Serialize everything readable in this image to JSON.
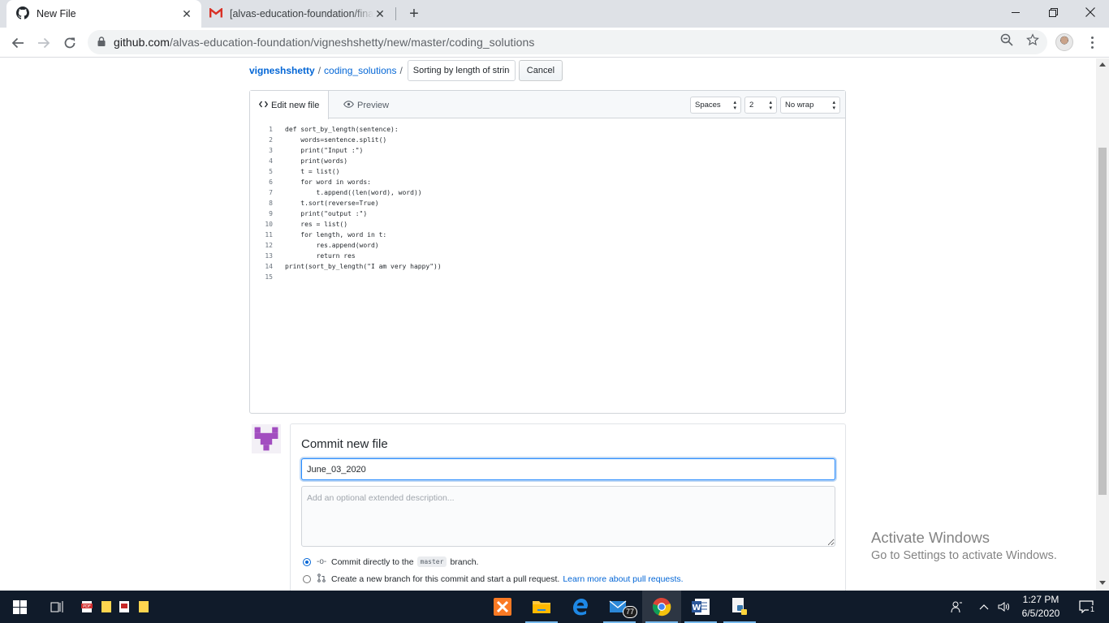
{
  "browser": {
    "tabs": [
      {
        "title": "New File",
        "icon": "github-icon",
        "active": true
      },
      {
        "title": "[alvas-education-foundation/fina",
        "icon": "gmail-icon",
        "active": false
      }
    ],
    "url_host": "github.com",
    "url_path": "/alvas-education-foundation/vigneshshetty/new/master/coding_solutions"
  },
  "breadcrumb": {
    "owner": "vigneshshetty",
    "sep1": "/",
    "folder": "coding_solutions",
    "sep2": "/",
    "filename": "Sorting by length of string",
    "cancel_label": "Cancel"
  },
  "editor": {
    "edit_tab": "Edit new file",
    "preview_tab": "Preview",
    "indent_mode": "Spaces",
    "indent_size": "2",
    "wrap_mode": "No wrap",
    "lines": [
      {
        "n": "1",
        "code": "def sort_by_length(sentence):"
      },
      {
        "n": "2",
        "code": "    words=sentence.split()"
      },
      {
        "n": "3",
        "code": "    print(\"Input :\")"
      },
      {
        "n": "4",
        "code": "    print(words)"
      },
      {
        "n": "5",
        "code": "    t = list()"
      },
      {
        "n": "6",
        "code": "    for word in words:"
      },
      {
        "n": "7",
        "code": "        t.append((len(word), word))"
      },
      {
        "n": "8",
        "code": "    t.sort(reverse=True)"
      },
      {
        "n": "9",
        "code": "    print(\"output :\")"
      },
      {
        "n": "10",
        "code": "    res = list()"
      },
      {
        "n": "11",
        "code": "    for length, word in t:"
      },
      {
        "n": "12",
        "code": "        res.append(word)"
      },
      {
        "n": "13",
        "code": "        return res"
      },
      {
        "n": "14",
        "code": "print(sort_by_length(\"I am very happy\"))"
      },
      {
        "n": "15",
        "code": ""
      }
    ]
  },
  "commit": {
    "title": "Commit new file",
    "summary_value": "June_03_2020",
    "description_placeholder": "Add an optional extended description...",
    "option_direct_pre": "Commit directly to the",
    "branch": "master",
    "option_direct_post": "branch.",
    "option_new_pre": "Create a",
    "option_new_bold": "new branch",
    "option_new_post": "for this commit and start a pull request.",
    "learn_more": "Learn more about pull requests."
  },
  "watermark": {
    "line1": "Activate Windows",
    "line2": "Go to Settings to activate Windows."
  },
  "taskbar": {
    "time": "1:27 PM",
    "date": "6/5/2020",
    "mail_badge": "77",
    "notification_count": "1"
  },
  "colors": {
    "link": "#0366d6",
    "taskbar": "#101b2a",
    "focus": "#2188ff"
  }
}
